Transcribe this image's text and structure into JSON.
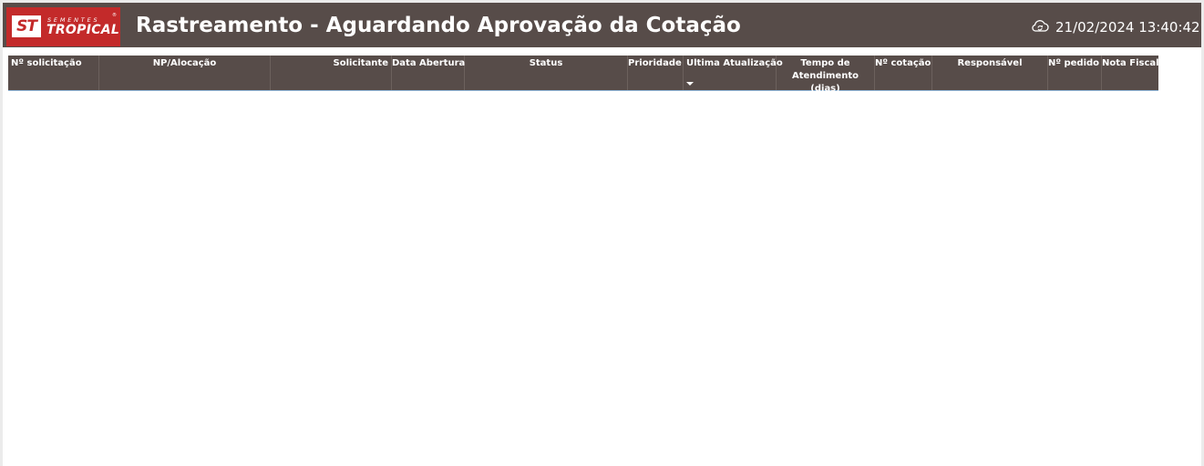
{
  "header": {
    "logo": {
      "mark": "ST",
      "line1": "SEMENTES",
      "line2": "TROPICAL",
      "registered": "®"
    },
    "title": "Rastreamento - Aguardando Aprovação da Cotação",
    "refresh_icon": "cloud-refresh-icon",
    "datetime": "21/02/2024 13:40:42"
  },
  "table": {
    "sorted_column": "Ultima Atualização",
    "sort_direction": "descending",
    "columns": [
      "Nº solicitação",
      "NP/Alocação",
      "Solicitante",
      "Data Abertura",
      "Status",
      "Prioridade",
      "Ultima Atualização",
      "Tempo de Atendimento (dias)",
      "Nº cotação",
      "Responsável",
      "Nº pedido",
      "Nota Fiscal"
    ],
    "rows": []
  },
  "colors": {
    "header_bg": "#574c49",
    "logo_bg": "#c32a2a",
    "page_bg": "#ffffff",
    "outer_bg": "#ebebeb"
  }
}
